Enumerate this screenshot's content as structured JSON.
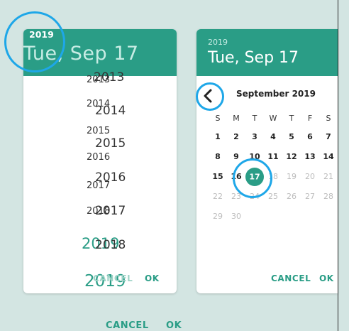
{
  "left_picker": {
    "year": "2019",
    "date": "Tue, Sep 17",
    "year_list": {
      "ghost_row": "2013",
      "rows": [
        "2013",
        "2014",
        "2014",
        "2015",
        "2015",
        "2016",
        "2016",
        "2017",
        "2017",
        "2018",
        "2019",
        "2019"
      ]
    },
    "cancel": "CANCEL",
    "ok": "OK"
  },
  "right_picker": {
    "year": "2019",
    "date": "Tue, Sep 17",
    "month": "September 2019",
    "weekdays": [
      "S",
      "M",
      "T",
      "W",
      "T",
      "F",
      "S"
    ],
    "weeks": [
      [
        "",
        "1",
        "2",
        "3",
        "4",
        "5",
        "6",
        "7"
      ],
      [
        "8",
        "9",
        "10",
        "11",
        "12",
        "13",
        "14"
      ],
      [
        "15",
        "16",
        "17",
        "18",
        "19",
        "20",
        "21"
      ],
      [
        "22",
        "23",
        "24",
        "25",
        "26",
        "27",
        "28"
      ],
      [
        "29",
        "30"
      ]
    ],
    "selected_day": "17",
    "cancel": "CANCEL",
    "ok": "OK"
  },
  "bottom_actions": {
    "cancel": "CANCEL",
    "ok": "OK"
  },
  "icons": {
    "prev": "chevron-left-icon"
  },
  "colors": {
    "accent": "#2a9d86",
    "highlight_ring": "#1ea7e8",
    "background": "#d3e5e2"
  }
}
